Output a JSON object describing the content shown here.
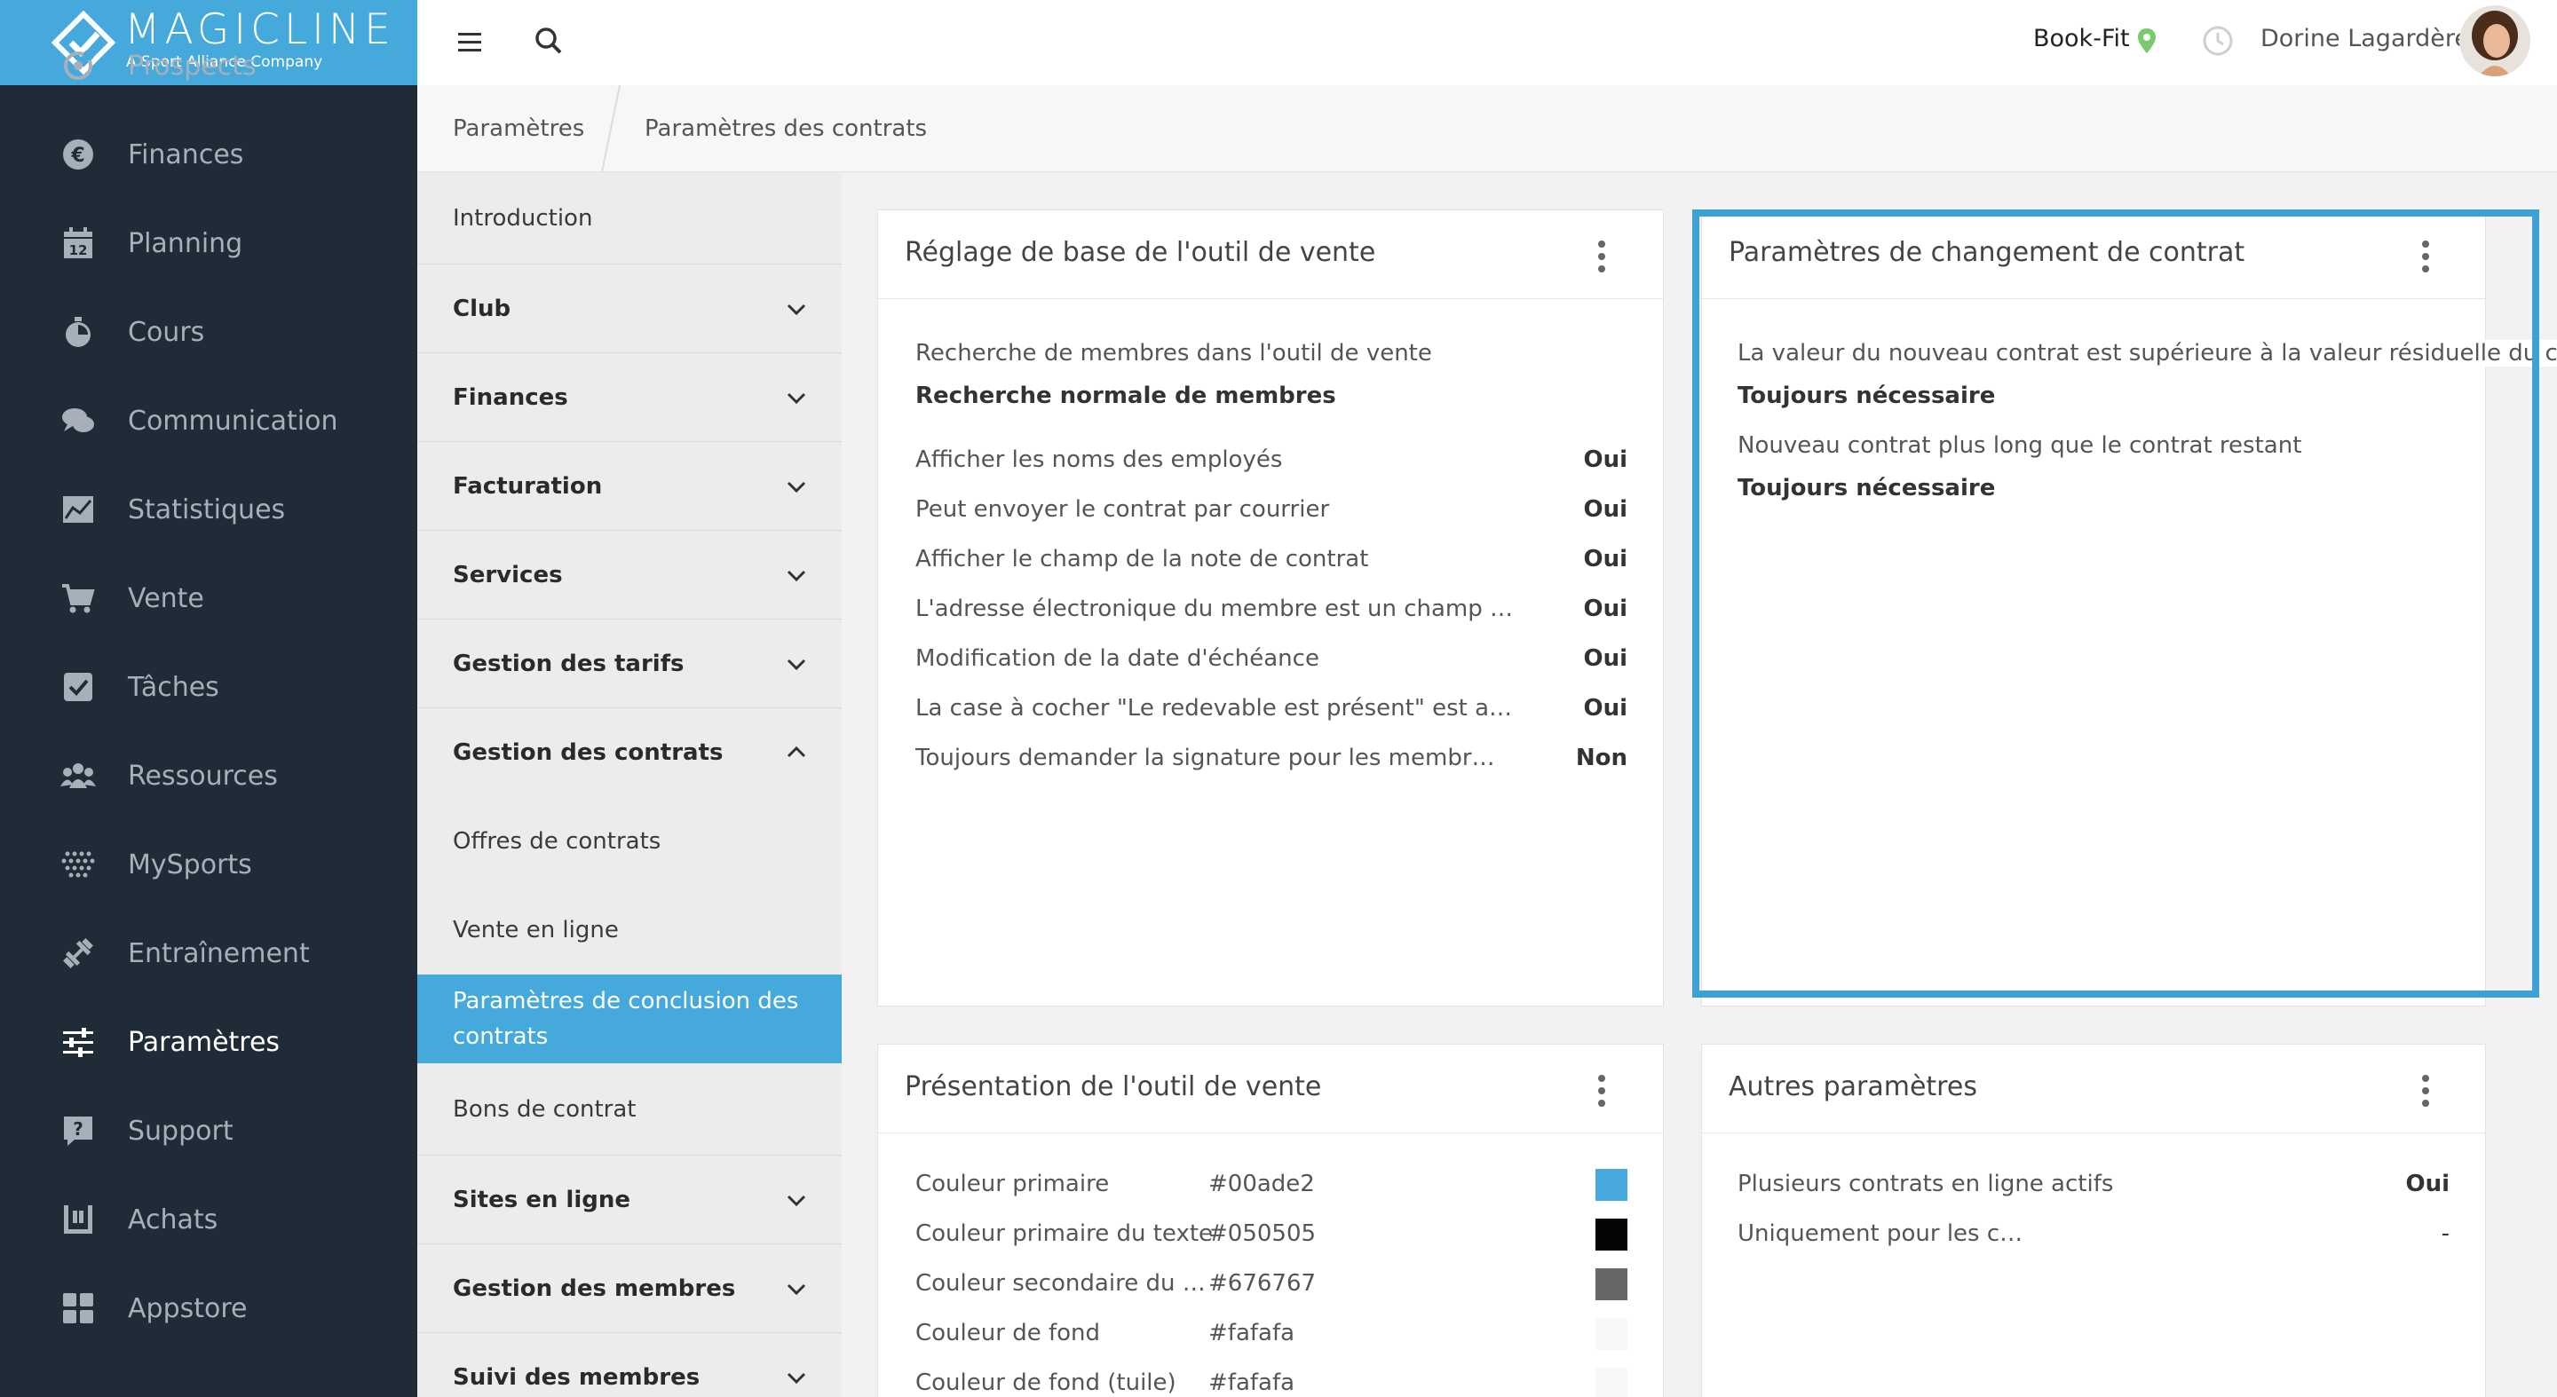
{
  "brand": {
    "name": "MAGICLINE",
    "tagline": "A Sport Alliance Company",
    "accent": "#45a9dc"
  },
  "sidebar": {
    "items": [
      {
        "label": "Prospects",
        "icon": "target-icon"
      },
      {
        "label": "Finances",
        "icon": "euro-icon"
      },
      {
        "label": "Planning",
        "icon": "calendar-icon"
      },
      {
        "label": "Cours",
        "icon": "stopwatch-icon"
      },
      {
        "label": "Communication",
        "icon": "chat-icon"
      },
      {
        "label": "Statistiques",
        "icon": "chart-icon"
      },
      {
        "label": "Vente",
        "icon": "cart-icon"
      },
      {
        "label": "Tâches",
        "icon": "checkbox-icon"
      },
      {
        "label": "Ressources",
        "icon": "group-icon"
      },
      {
        "label": "MySports",
        "icon": "dots-grid-icon"
      },
      {
        "label": "Entraînement",
        "icon": "dumbbell-icon"
      },
      {
        "label": "Paramètres",
        "icon": "sliders-icon"
      },
      {
        "label": "Support",
        "icon": "help-icon"
      },
      {
        "label": "Achats",
        "icon": "store-icon"
      },
      {
        "label": "Appstore",
        "icon": "apps-icon"
      }
    ],
    "calendar_day": "12"
  },
  "topbar": {
    "club": "Book-Fit",
    "user": "Dorine Lagardère"
  },
  "breadcrumb": {
    "level1": "Paramètres",
    "level2": "Paramètres des contrats"
  },
  "submenu": {
    "items": [
      {
        "label": "Introduction"
      },
      {
        "label": "Club"
      },
      {
        "label": "Finances"
      },
      {
        "label": "Facturation"
      },
      {
        "label": "Services"
      },
      {
        "label": "Gestion des tarifs"
      },
      {
        "label": "Gestion des contrats"
      },
      {
        "label": "Offres de contrats"
      },
      {
        "label": "Vente en ligne"
      },
      {
        "label": "Paramètres de conclusion des contrats"
      },
      {
        "label": "Bons de contrat"
      },
      {
        "label": "Sites en ligne"
      },
      {
        "label": "Gestion des membres"
      },
      {
        "label": "Suivi des membres"
      }
    ]
  },
  "card_sales_base": {
    "title": "Réglage de base de l'outil de vente",
    "search_label": "Recherche de membres dans l'outil de vente",
    "search_value": "Recherche normale de membres",
    "rows": [
      {
        "label": "Afficher les noms des employés",
        "value": "Oui"
      },
      {
        "label": "Peut envoyer le contrat par courrier",
        "value": "Oui"
      },
      {
        "label": "Afficher le champ de la note de contrat",
        "value": "Oui"
      },
      {
        "label": "L'adresse électronique du membre est un champ …",
        "value": "Oui"
      },
      {
        "label": "Modification de la date d'échéance",
        "value": "Oui"
      },
      {
        "label": "La case à cocher \"Le redevable est présent\" est a…",
        "value": "Oui"
      },
      {
        "label": "Toujours demander la signature pour les membr…",
        "value": "Non"
      }
    ]
  },
  "card_contract_change": {
    "title": "Paramètres de changement de contrat",
    "rows": [
      {
        "label": "La valeur du nouveau contrat est supérieure à la valeur résiduelle du contrat",
        "value": "Toujours nécessaire"
      },
      {
        "label": "Nouveau contrat plus long que le contrat restant",
        "value": "Toujours nécessaire"
      }
    ]
  },
  "card_presentation": {
    "title": "Présentation de l'outil de vente",
    "rows": [
      {
        "label": "Couleur primaire",
        "value": "#00ade2",
        "swatch": "#45a9dc"
      },
      {
        "label": "Couleur primaire du texte",
        "value": "#050505",
        "swatch": "#050505"
      },
      {
        "label": "Couleur secondaire du …",
        "value": "#676767",
        "swatch": "#676767"
      },
      {
        "label": "Couleur de fond",
        "value": "#fafafa",
        "swatch": "#f7f7f7"
      },
      {
        "label": "Couleur de fond (tuile)",
        "value": "#fafafa",
        "swatch": "#f7f7f7"
      }
    ]
  },
  "card_other": {
    "title": "Autres paramètres",
    "rows": [
      {
        "label": "Plusieurs contrats en ligne actifs",
        "value": "Oui"
      },
      {
        "label": "Uniquement pour les c…",
        "value": "-"
      }
    ]
  }
}
